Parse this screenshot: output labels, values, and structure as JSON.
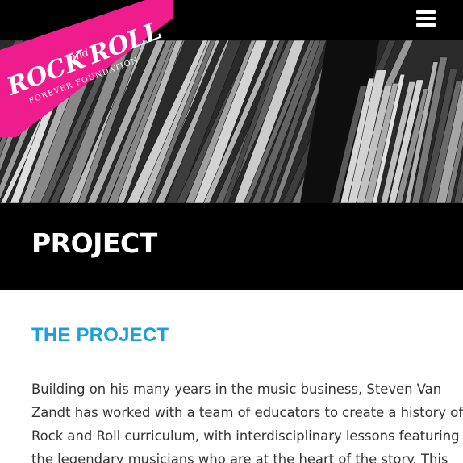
{
  "header": {
    "menu_icon": "hamburger-menu-icon",
    "background": "#000000"
  },
  "logo": {
    "line1_a": "ROCK",
    "line1_and": "and",
    "line1_b": "ROLL",
    "line2": "FOREVER FOUNDATION",
    "color": "#ee1c8c"
  },
  "hero": {
    "image": "black-and-white vinyl record sleeves"
  },
  "title_band": {
    "title": "PROJECT"
  },
  "main": {
    "heading": "THE PROJECT",
    "heading_color": "#1ca0dc",
    "paragraph_lines": [
      "Building on his many years in the music business, Steven Van",
      "Zandt has worked with a team of educators to create a history of",
      "Rock and Roll curriculum, with interdisciplinary lessons featuring",
      "the legendary musicians who are at the heart of the story. This"
    ]
  }
}
